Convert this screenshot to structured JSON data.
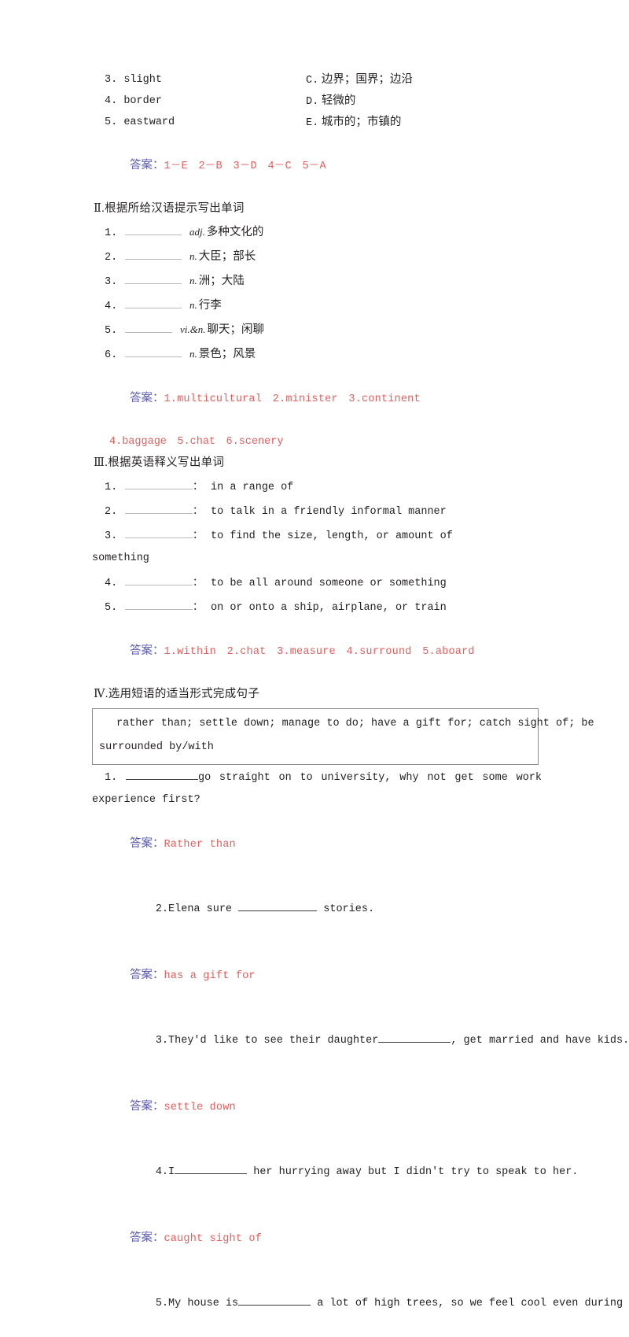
{
  "matching": {
    "items": [
      {
        "num": "3.",
        "word": "slight",
        "letter": "C.",
        "meaning": "边界；国界；边沿"
      },
      {
        "num": "4.",
        "word": "border",
        "letter": "D.",
        "meaning": "轻微的"
      },
      {
        "num": "5.",
        "word": "eastward",
        "letter": "E.",
        "meaning": "城市的；市镇的"
      }
    ],
    "answer_label": "答案：",
    "answer_text": "1－E　2－B　3－D　4－C　5－A"
  },
  "section2": {
    "heading_numeral": "Ⅱ",
    "heading_text": ".根据所给汉语提示写出单词",
    "items": [
      {
        "num": "1.",
        "pos": "adj.",
        "zh": "多种文化的"
      },
      {
        "num": "2.",
        "pos": "n.",
        "zh": "大臣；部长"
      },
      {
        "num": "3.",
        "pos": "n.",
        "zh": "洲；大陆"
      },
      {
        "num": "4.",
        "pos": "n.",
        "zh": "行李"
      },
      {
        "num": "5.",
        "pos": "vi.&n.",
        "zh": "聊天；闲聊"
      },
      {
        "num": "6.",
        "pos": "n.",
        "zh": "景色；风景"
      }
    ],
    "answer_label": "答案：",
    "answer_line1": "1.multicultural　2.minister　3.continent",
    "answer_line2": "4.baggage　5.chat　6.scenery"
  },
  "section3": {
    "heading_numeral": "Ⅲ",
    "heading_text": ".根据英语释义写出单词",
    "items": [
      {
        "num": "1.",
        "definition": "in a range of"
      },
      {
        "num": "2.",
        "definition": "to talk in a friendly informal manner"
      },
      {
        "num": "3.",
        "definition": "to find the size, length, or amount of"
      },
      {
        "num": "4.",
        "definition": "to be all around someone or something"
      },
      {
        "num": "5.",
        "definition": "on or onto a ship, airplane, or train"
      }
    ],
    "item3_continuation": "something",
    "colon": "：",
    "answer_label": "答案：",
    "answer_text": "1.within　2.chat　3.measure　4.surround　5.aboard"
  },
  "section4": {
    "heading_numeral": "Ⅳ",
    "heading_text": ".选用短语的适当形式完成句子",
    "phrase_box_line1": "rather than; settle down; manage to do; have a gift for; catch sight of; be",
    "phrase_box_line2": "surrounded by/with",
    "questions": [
      {
        "num": "1.",
        "text_before": "",
        "text_after": "go straight on to university, why not get some work",
        "continuation": "experience first?",
        "answer_label": "答案：",
        "answer_text": "Rather than"
      },
      {
        "num": "2.",
        "text_before": "Elena sure ",
        "text_after": " stories.",
        "continuation": "",
        "answer_label": "答案：",
        "answer_text": "has a gift for"
      },
      {
        "num": "3.",
        "text_before": "They'd like to see their daughter",
        "text_after": ", get married and have kids.",
        "continuation": "",
        "answer_label": "答案：",
        "answer_text": "settle down"
      },
      {
        "num": "4.",
        "text_before": "I",
        "text_after": " her hurrying away but I didn't try to speak to her.",
        "continuation": "",
        "answer_label": "答案：",
        "answer_text": "caught sight of"
      },
      {
        "num": "5.",
        "text_before": "My house is",
        "text_after": " a lot of high trees, so we feel cool even during",
        "continuation": "",
        "answer_label": "",
        "answer_text": ""
      }
    ]
  },
  "colors": {
    "answer_label": "#5b5bb0",
    "answer_text": "#e0605e",
    "body_text": "#231f20",
    "blank_rule": "#b9b9b9",
    "box_border": "#8c8c8c"
  }
}
